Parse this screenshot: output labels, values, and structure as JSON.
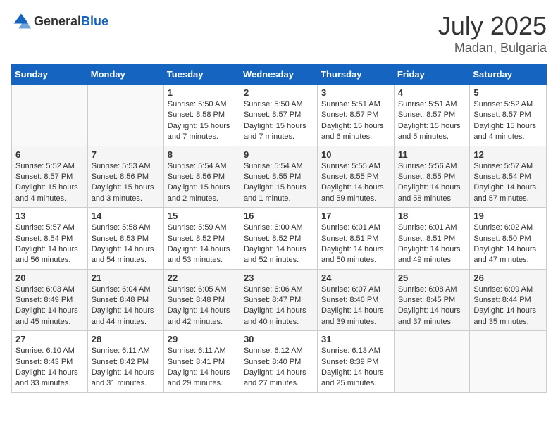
{
  "header": {
    "logo_general": "General",
    "logo_blue": "Blue",
    "month_year": "July 2025",
    "location": "Madan, Bulgaria"
  },
  "days_of_week": [
    "Sunday",
    "Monday",
    "Tuesday",
    "Wednesday",
    "Thursday",
    "Friday",
    "Saturday"
  ],
  "weeks": [
    [
      {
        "day": "",
        "content": ""
      },
      {
        "day": "",
        "content": ""
      },
      {
        "day": "1",
        "content": "Sunrise: 5:50 AM\nSunset: 8:58 PM\nDaylight: 15 hours and 7 minutes."
      },
      {
        "day": "2",
        "content": "Sunrise: 5:50 AM\nSunset: 8:57 PM\nDaylight: 15 hours and 7 minutes."
      },
      {
        "day": "3",
        "content": "Sunrise: 5:51 AM\nSunset: 8:57 PM\nDaylight: 15 hours and 6 minutes."
      },
      {
        "day": "4",
        "content": "Sunrise: 5:51 AM\nSunset: 8:57 PM\nDaylight: 15 hours and 5 minutes."
      },
      {
        "day": "5",
        "content": "Sunrise: 5:52 AM\nSunset: 8:57 PM\nDaylight: 15 hours and 4 minutes."
      }
    ],
    [
      {
        "day": "6",
        "content": "Sunrise: 5:52 AM\nSunset: 8:57 PM\nDaylight: 15 hours and 4 minutes."
      },
      {
        "day": "7",
        "content": "Sunrise: 5:53 AM\nSunset: 8:56 PM\nDaylight: 15 hours and 3 minutes."
      },
      {
        "day": "8",
        "content": "Sunrise: 5:54 AM\nSunset: 8:56 PM\nDaylight: 15 hours and 2 minutes."
      },
      {
        "day": "9",
        "content": "Sunrise: 5:54 AM\nSunset: 8:55 PM\nDaylight: 15 hours and 1 minute."
      },
      {
        "day": "10",
        "content": "Sunrise: 5:55 AM\nSunset: 8:55 PM\nDaylight: 14 hours and 59 minutes."
      },
      {
        "day": "11",
        "content": "Sunrise: 5:56 AM\nSunset: 8:55 PM\nDaylight: 14 hours and 58 minutes."
      },
      {
        "day": "12",
        "content": "Sunrise: 5:57 AM\nSunset: 8:54 PM\nDaylight: 14 hours and 57 minutes."
      }
    ],
    [
      {
        "day": "13",
        "content": "Sunrise: 5:57 AM\nSunset: 8:54 PM\nDaylight: 14 hours and 56 minutes."
      },
      {
        "day": "14",
        "content": "Sunrise: 5:58 AM\nSunset: 8:53 PM\nDaylight: 14 hours and 54 minutes."
      },
      {
        "day": "15",
        "content": "Sunrise: 5:59 AM\nSunset: 8:52 PM\nDaylight: 14 hours and 53 minutes."
      },
      {
        "day": "16",
        "content": "Sunrise: 6:00 AM\nSunset: 8:52 PM\nDaylight: 14 hours and 52 minutes."
      },
      {
        "day": "17",
        "content": "Sunrise: 6:01 AM\nSunset: 8:51 PM\nDaylight: 14 hours and 50 minutes."
      },
      {
        "day": "18",
        "content": "Sunrise: 6:01 AM\nSunset: 8:51 PM\nDaylight: 14 hours and 49 minutes."
      },
      {
        "day": "19",
        "content": "Sunrise: 6:02 AM\nSunset: 8:50 PM\nDaylight: 14 hours and 47 minutes."
      }
    ],
    [
      {
        "day": "20",
        "content": "Sunrise: 6:03 AM\nSunset: 8:49 PM\nDaylight: 14 hours and 45 minutes."
      },
      {
        "day": "21",
        "content": "Sunrise: 6:04 AM\nSunset: 8:48 PM\nDaylight: 14 hours and 44 minutes."
      },
      {
        "day": "22",
        "content": "Sunrise: 6:05 AM\nSunset: 8:48 PM\nDaylight: 14 hours and 42 minutes."
      },
      {
        "day": "23",
        "content": "Sunrise: 6:06 AM\nSunset: 8:47 PM\nDaylight: 14 hours and 40 minutes."
      },
      {
        "day": "24",
        "content": "Sunrise: 6:07 AM\nSunset: 8:46 PM\nDaylight: 14 hours and 39 minutes."
      },
      {
        "day": "25",
        "content": "Sunrise: 6:08 AM\nSunset: 8:45 PM\nDaylight: 14 hours and 37 minutes."
      },
      {
        "day": "26",
        "content": "Sunrise: 6:09 AM\nSunset: 8:44 PM\nDaylight: 14 hours and 35 minutes."
      }
    ],
    [
      {
        "day": "27",
        "content": "Sunrise: 6:10 AM\nSunset: 8:43 PM\nDaylight: 14 hours and 33 minutes."
      },
      {
        "day": "28",
        "content": "Sunrise: 6:11 AM\nSunset: 8:42 PM\nDaylight: 14 hours and 31 minutes."
      },
      {
        "day": "29",
        "content": "Sunrise: 6:11 AM\nSunset: 8:41 PM\nDaylight: 14 hours and 29 minutes."
      },
      {
        "day": "30",
        "content": "Sunrise: 6:12 AM\nSunset: 8:40 PM\nDaylight: 14 hours and 27 minutes."
      },
      {
        "day": "31",
        "content": "Sunrise: 6:13 AM\nSunset: 8:39 PM\nDaylight: 14 hours and 25 minutes."
      },
      {
        "day": "",
        "content": ""
      },
      {
        "day": "",
        "content": ""
      }
    ]
  ]
}
